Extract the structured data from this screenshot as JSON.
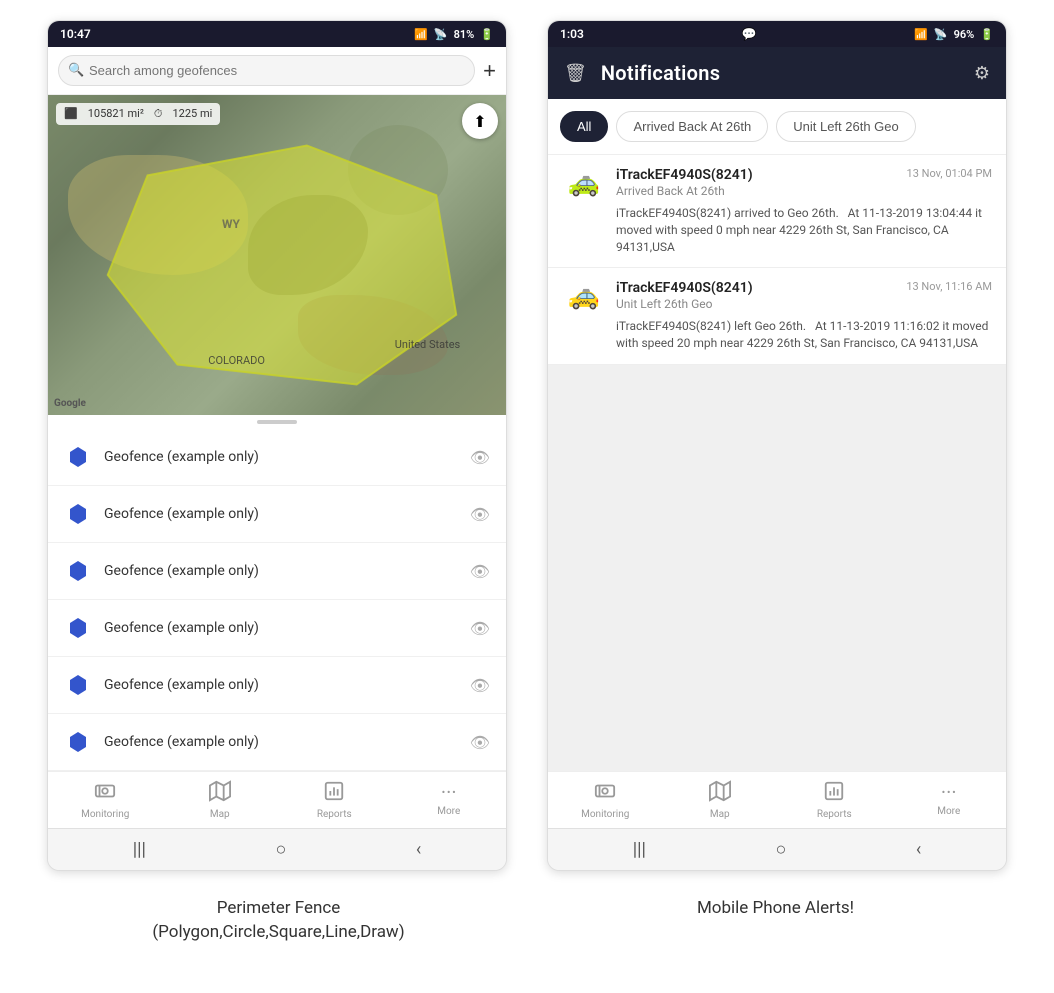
{
  "left_phone": {
    "status_bar": {
      "time": "10:47",
      "wifi": "WiFi",
      "signal": "Signal",
      "battery": "81%"
    },
    "search": {
      "placeholder": "Search among geofences"
    },
    "map": {
      "area_label": "105821 mi²",
      "distance_label": "1225 mi",
      "label_wy": "WY",
      "label_us": "United States",
      "label_co": "COLORADO"
    },
    "geofences": [
      {
        "name": "Geofence (example only)"
      },
      {
        "name": "Geofence (example only)"
      },
      {
        "name": "Geofence (example only)"
      },
      {
        "name": "Geofence (example only)"
      },
      {
        "name": "Geofence (example only)"
      },
      {
        "name": "Geofence (example only)"
      }
    ],
    "nav": {
      "items": [
        {
          "label": "Monitoring",
          "icon": "🚌"
        },
        {
          "label": "Map",
          "icon": "🗺"
        },
        {
          "label": "Reports",
          "icon": "📊"
        },
        {
          "label": "More",
          "icon": "···"
        }
      ]
    },
    "caption": "Perimeter Fence\n(Polygon,Circle,Square,Line,Draw)"
  },
  "right_phone": {
    "status_bar": {
      "time": "1:03",
      "battery": "96%"
    },
    "header": {
      "title": "Notifications",
      "delete_icon": "🗑",
      "settings_icon": "⚙"
    },
    "filter_tabs": [
      {
        "label": "All",
        "active": true
      },
      {
        "label": "Arrived Back At 26th",
        "active": false
      },
      {
        "label": "Unit Left 26th Geo",
        "active": false
      }
    ],
    "notifications": [
      {
        "device": "iTrackEF4940S(8241)",
        "event_type": "Arrived Back At 26th",
        "timestamp": "13 Nov, 01:04 PM",
        "body": "iTrackEF4940S(8241) arrived to Geo 26th.   At 11-13-2019 13:04:44 it moved with speed 0 mph near 4229 26th St, San Francisco, CA 94131,USA",
        "car_color": "#FFB800"
      },
      {
        "device": "iTrackEF4940S(8241)",
        "event_type": "Unit Left 26th Geo",
        "timestamp": "13 Nov, 11:16 AM",
        "body": "iTrackEF4940S(8241) left Geo 26th.   At 11-13-2019 11:16:02 it moved with speed 20 mph near 4229 26th St, San Francisco, CA 94131,USA",
        "car_color": "#FFB800"
      }
    ],
    "nav": {
      "items": [
        {
          "label": "Monitoring",
          "icon": "🚌"
        },
        {
          "label": "Map",
          "icon": "🗺"
        },
        {
          "label": "Reports",
          "icon": "📊"
        },
        {
          "label": "More",
          "icon": "···"
        }
      ]
    },
    "caption": "Mobile Phone Alerts!"
  }
}
